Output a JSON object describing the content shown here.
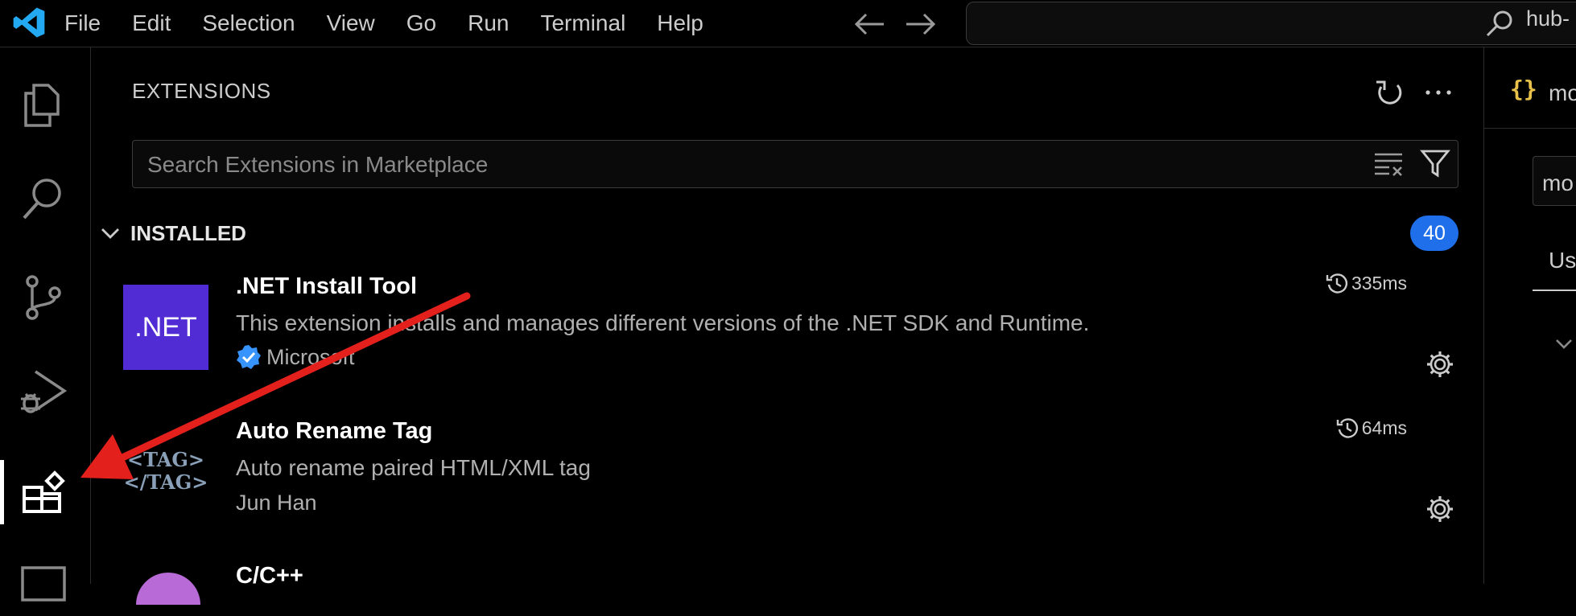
{
  "titlebar": {
    "menu": [
      "File",
      "Edit",
      "Selection",
      "View",
      "Go",
      "Run",
      "Terminal",
      "Help"
    ],
    "command_center_text": "hub-"
  },
  "sidebar": {
    "title": "EXTENSIONS",
    "search_placeholder": "Search Extensions in Marketplace",
    "section": {
      "label": "INSTALLED",
      "count": "40"
    },
    "extensions": [
      {
        "icon_text": ".NET",
        "name": ".NET Install Tool",
        "description": "This extension installs and manages different versions of the .NET SDK and Runtime.",
        "publisher": "Microsoft",
        "verified": true,
        "activation_time": "335ms"
      },
      {
        "name": "Auto Rename Tag",
        "description": "Auto rename paired HTML/XML tag",
        "publisher": "Jun Han",
        "verified": false,
        "activation_time": "64ms"
      },
      {
        "name": "C/C++"
      }
    ]
  },
  "editor": {
    "tab_icon": "{}",
    "tab_label": "mo",
    "input_text": "mo",
    "tab_text": "Us"
  },
  "colors": {
    "background": "#000000",
    "text": "#cccccc",
    "badge": "#1f6feb",
    "net_icon": "#512bd4",
    "vscode_blue": "#23a9f2",
    "annotation_arrow": "#e3201b",
    "verified_blue": "#3794ff"
  },
  "icons": {
    "logo": "vscode-logo-icon",
    "activity": [
      "explorer-icon",
      "search-icon",
      "source-control-icon",
      "run-debug-icon",
      "extensions-icon",
      "panel-icon"
    ]
  }
}
